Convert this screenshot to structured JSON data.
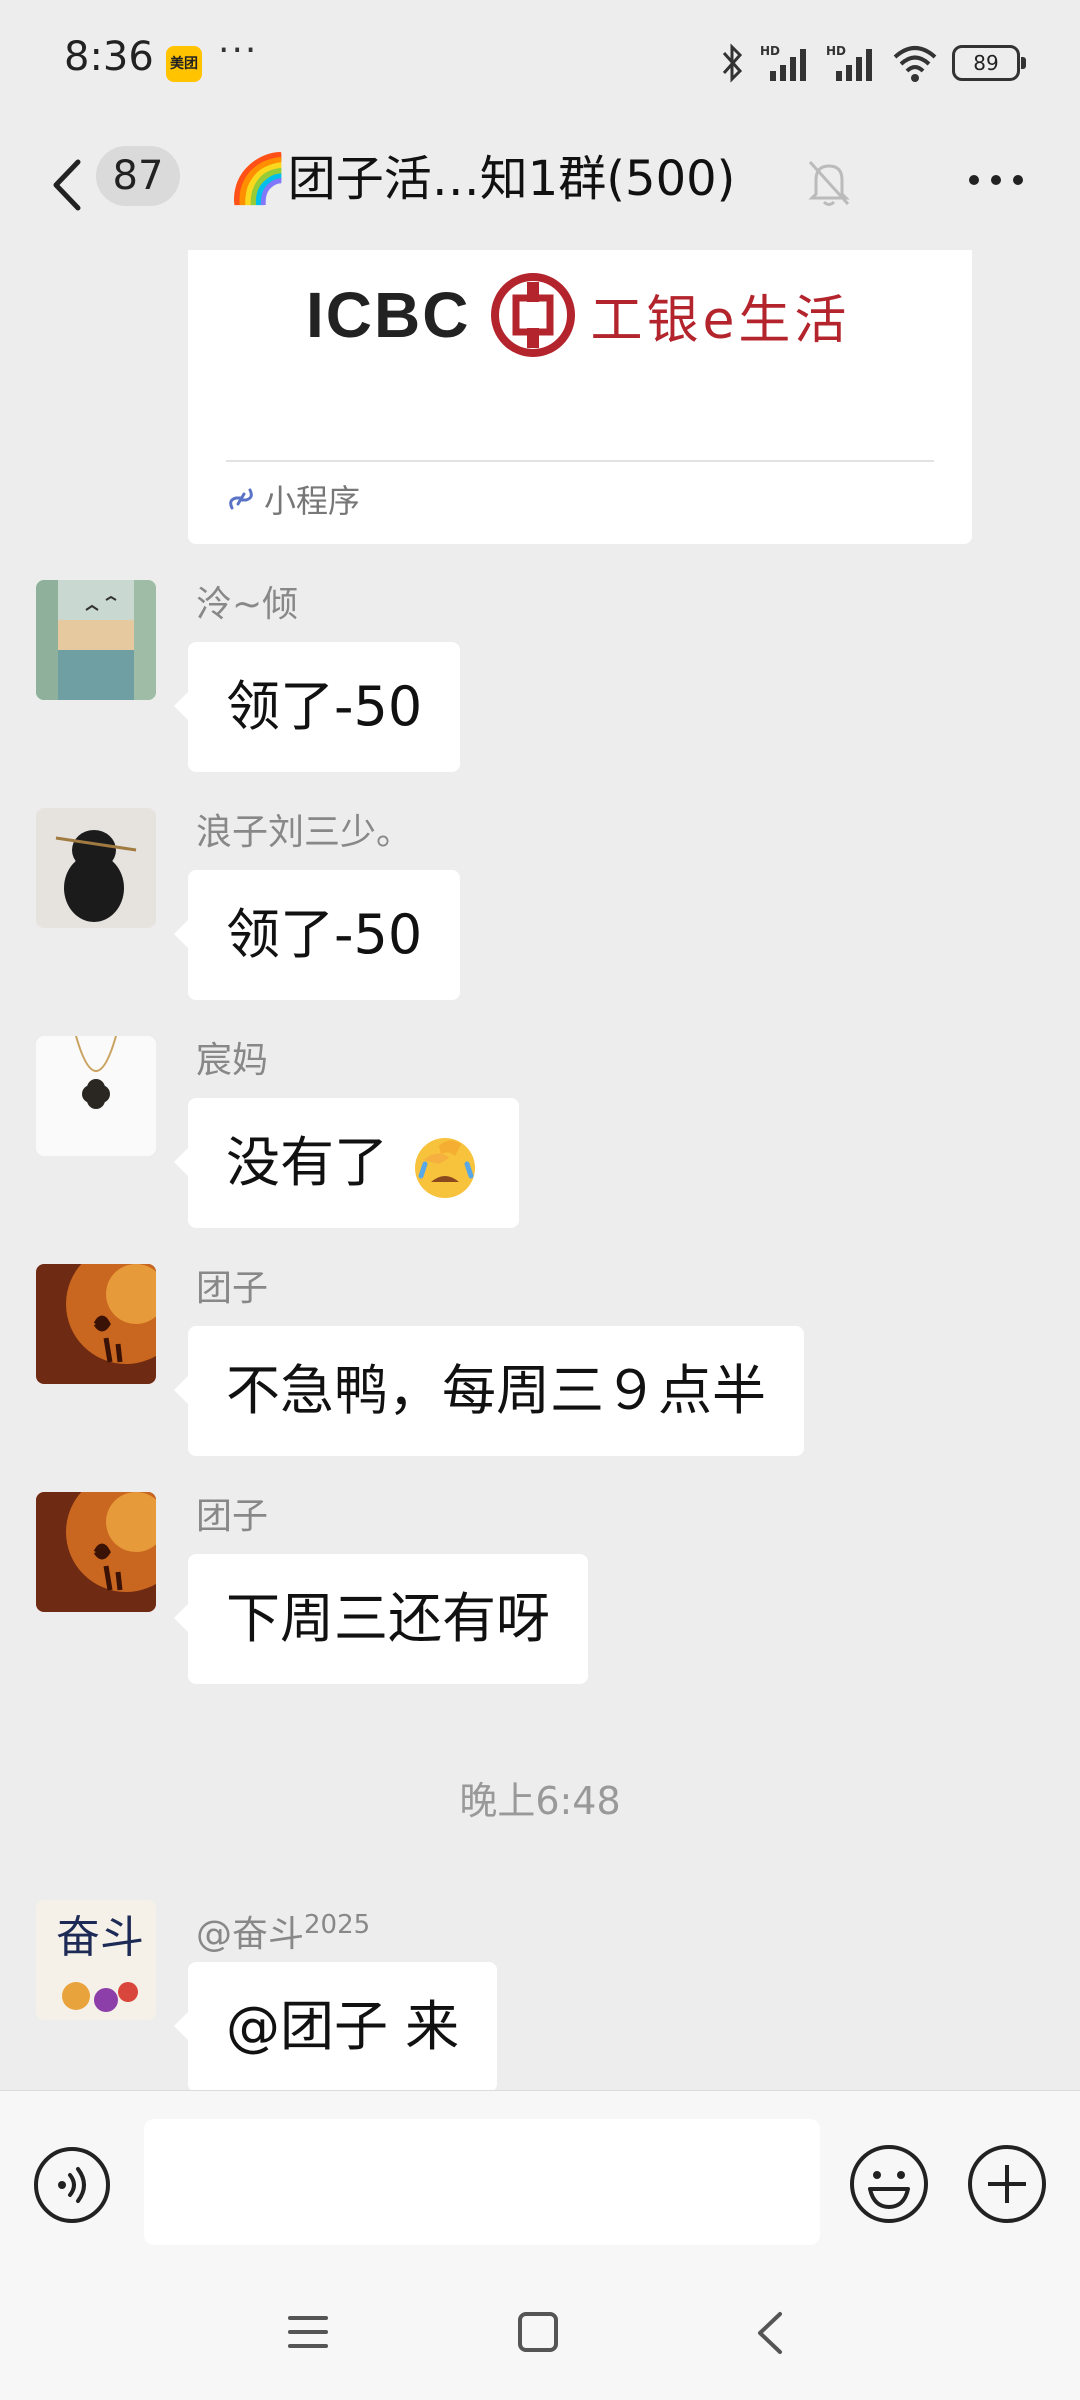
{
  "status_bar": {
    "time": "8:36",
    "app_badge": "美团",
    "more": "···",
    "battery": "89"
  },
  "nav": {
    "unread_count": "87",
    "title": "🌈团子活…知1群(500)"
  },
  "mini_program": {
    "brand_en": "ICBC",
    "brand_cn": "工银e生活",
    "type_label": "小程序"
  },
  "messages": [
    {
      "sender": "泠~倾",
      "text": "领了-50"
    },
    {
      "sender": "浪子刘三少。",
      "text": "领了-50"
    },
    {
      "sender": "宸妈",
      "text": "没有了"
    },
    {
      "sender": "团子",
      "text": "不急鸭，每周三９点半"
    },
    {
      "sender": "团子",
      "text": "下周三还有呀"
    }
  ],
  "timestamp": "晚上6:48",
  "last_message": {
    "sender": "@奋斗",
    "sender_sup": "2025",
    "text": "@团子  来"
  },
  "avatar_texts": {
    "fendou": "奋斗"
  },
  "colors": {
    "background": "#ededed",
    "bubble": "#ffffff",
    "icbc_red": "#b3242c"
  }
}
